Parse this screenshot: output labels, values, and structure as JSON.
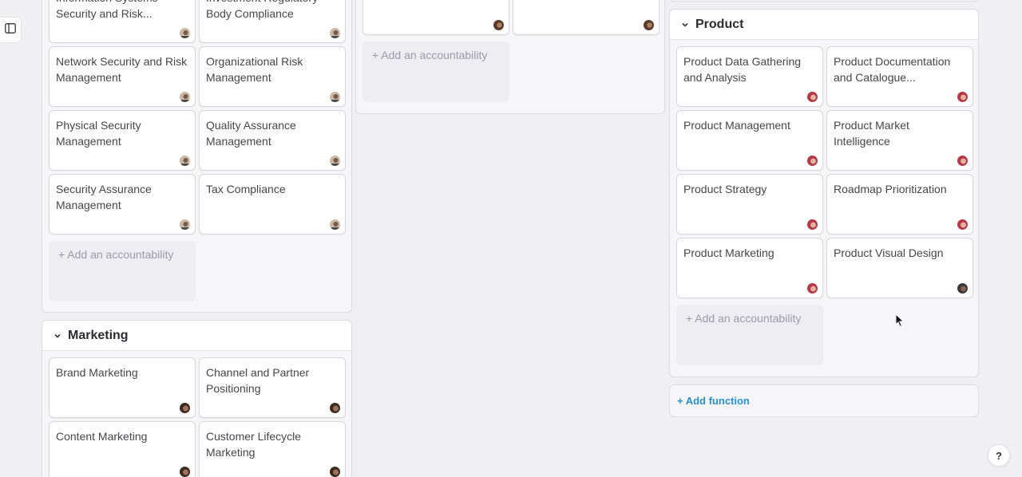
{
  "sidebar": {
    "toggle_icon": "sidebar-panel-icon"
  },
  "security_panel": {
    "cards": [
      {
        "label": "Information Systems Security and Risk...",
        "owner": "person-a"
      },
      {
        "label": "Investment Regulatory Body Compliance",
        "owner": "person-a"
      },
      {
        "label": "Network Security and Risk Management",
        "owner": "person-a"
      },
      {
        "label": "Organizational Risk Management",
        "owner": "person-a"
      },
      {
        "label": "Physical Security Management",
        "owner": "person-a"
      },
      {
        "label": "Quality Assurance Management",
        "owner": "person-a"
      },
      {
        "label": "Security Assurance Management",
        "owner": "person-a"
      },
      {
        "label": "Tax Compliance",
        "owner": "person-a"
      }
    ],
    "add_label": "+ Add an accountability"
  },
  "marketing_panel": {
    "title": "Marketing",
    "cards": [
      {
        "label": "Brand Marketing",
        "owner": "person-b"
      },
      {
        "label": "Channel and Partner Positioning",
        "owner": "person-b"
      },
      {
        "label": "Content Marketing",
        "owner": "person-b"
      },
      {
        "label": "Customer Lifecycle Marketing",
        "owner": "person-b"
      }
    ]
  },
  "middle_panel": {
    "add_label": "+ Add an accountability"
  },
  "product_panel": {
    "title": "Product",
    "cards": [
      {
        "label": "Product Data Gathering and Analysis",
        "owner": "person-c"
      },
      {
        "label": "Product Documentation and Catalogue...",
        "owner": "person-c"
      },
      {
        "label": "Product Management",
        "owner": "person-c"
      },
      {
        "label": "Product Market Intelligence",
        "owner": "person-c"
      },
      {
        "label": "Product Strategy",
        "owner": "person-c"
      },
      {
        "label": "Roadmap Prioritization",
        "owner": "person-c"
      },
      {
        "label": "Product Marketing",
        "owner": "person-c"
      },
      {
        "label": "Product Visual Design",
        "owner": "person-d"
      }
    ],
    "add_label": "+ Add an accountability"
  },
  "add_function_label": "+ Add function",
  "help_label": "?",
  "colors": {
    "accent": "#2a8ec9",
    "panel_bg": "#f6f6f9",
    "page_bg": "#f0f0f3"
  }
}
